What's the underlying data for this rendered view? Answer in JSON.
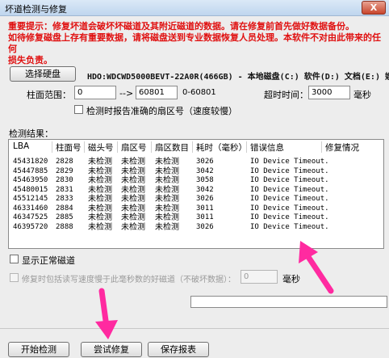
{
  "window": {
    "title": "坏道检测与修复",
    "close_label": "X"
  },
  "warning": {
    "line1": "重要提示：修复坏道会破坏坏磁道及其附近磁道的数据。请在修复前首先做好数据备份。",
    "line2": "如待修复磁盘上存有重要数据，请将磁盘送到专业数据恢复人员处理。本软件不对由此带来的任何",
    "line3": "损失负责。"
  },
  "disk": {
    "select_label": "选择硬盘",
    "info": "HDO:WDCWD5000BEVT-22A0R(466GB) - 本地磁盘(C:) 软件(D:) 文档(E:) 娱乐"
  },
  "range": {
    "label": "柱面范围：",
    "start": "0",
    "arrow": "-->",
    "end": "60801",
    "span": "0-60801",
    "timeout_label": "超时时间：",
    "timeout_value": "3000",
    "timeout_unit": "毫秒"
  },
  "options": {
    "report_sector": "检测时报告准确的扇区号（速度较慢）",
    "show_normal": "显示正常磁道",
    "repair_slow": "修复时包括读写速度慢于此毫秒数的好磁道（不破坏数据）：",
    "repair_slow_value": "0",
    "repair_slow_unit": "毫秒"
  },
  "results": {
    "label": "检测结果：",
    "columns": [
      "LBA",
      "柱面号",
      "磁头号",
      "扇区号",
      "扇区数目",
      "耗时（毫秒）",
      "错误信息",
      "修复情况"
    ],
    "rows": [
      [
        "45431820",
        "2828",
        "未检测",
        "未检测",
        "未检测",
        "3026",
        "IO Device Timeout.",
        ""
      ],
      [
        "45447885",
        "2829",
        "未检测",
        "未检测",
        "未检测",
        "3042",
        "IO Device Timeout.",
        ""
      ],
      [
        "45463950",
        "2830",
        "未检测",
        "未检测",
        "未检测",
        "3058",
        "IO Device Timeout.",
        ""
      ],
      [
        "45480015",
        "2831",
        "未检测",
        "未检测",
        "未检测",
        "3042",
        "IO Device Timeout.",
        ""
      ],
      [
        "45512145",
        "2833",
        "未检测",
        "未检测",
        "未检测",
        "3026",
        "IO Device Timeout.",
        ""
      ],
      [
        "46331460",
        "2884",
        "未检测",
        "未检测",
        "未检测",
        "3011",
        "IO Device Timeout.",
        ""
      ],
      [
        "46347525",
        "2885",
        "未检测",
        "未检测",
        "未检测",
        "3011",
        "IO Device Timeout.",
        ""
      ],
      [
        "46395720",
        "2888",
        "未检测",
        "未检测",
        "未检测",
        "3026",
        "IO Device Timeout.",
        ""
      ]
    ]
  },
  "progress": {
    "fraction": 0
  },
  "buttons": {
    "start": "开始检测",
    "repair": "尝试修复",
    "save": "保存报表"
  },
  "colors": {
    "warning": "#e01010",
    "annotation_arrow": "#ff2aa0"
  }
}
